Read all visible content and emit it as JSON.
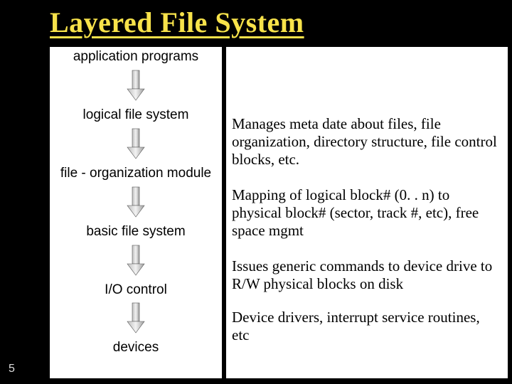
{
  "title": "Layered File System",
  "page_number": "5",
  "diagram": {
    "layers": [
      "application programs",
      "logical file system",
      "file - organization module",
      "basic file system",
      "I/O control",
      "devices"
    ]
  },
  "notes": {
    "logical_fs": "Manages meta date about files, file organization, directory structure, file control blocks, etc.",
    "file_org": "Mapping of logical block# (0. . n) to physical block# (sector, track #, etc), free space mgmt",
    "basic_fs": "Issues generic commands to device drive to R/W physical blocks on disk",
    "io_control": "Device drivers, interrupt service routines, etc"
  }
}
